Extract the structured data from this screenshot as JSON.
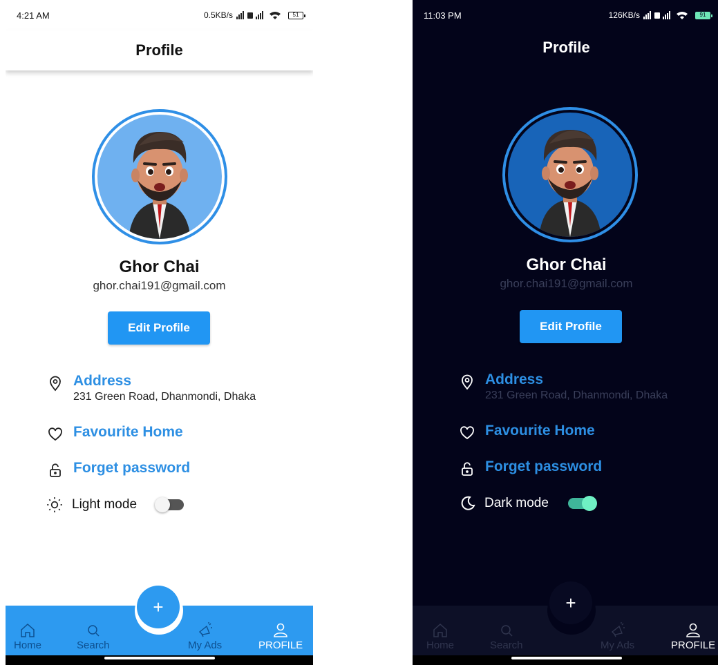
{
  "screens": {
    "light": {
      "status_time": "4:21 AM",
      "status_speed": "0.5KB/s",
      "battery": "51",
      "title": "Profile",
      "name": "Ghor Chai",
      "email": "ghor.chai191@gmail.com",
      "edit_label": "Edit Profile",
      "address_title": "Address",
      "address_value": "231 Green Road, Dhanmondi, Dhaka",
      "favourite_label": "Favourite Home",
      "forget_label": "Forget password",
      "mode_label": "Light mode",
      "mode_on": false,
      "nav": {
        "home": "Home",
        "search": "Search",
        "ads": "My Ads",
        "profile": "PROFILE"
      },
      "fab": "+"
    },
    "dark": {
      "status_time": "11:03 PM",
      "status_speed": "126KB/s",
      "battery": "91",
      "title": "Profile",
      "name": "Ghor Chai",
      "email": "ghor.chai191@gmail.com",
      "edit_label": "Edit Profile",
      "address_title": "Address",
      "address_value": "231 Green Road, Dhanmondi, Dhaka",
      "favourite_label": "Favourite Home",
      "forget_label": "Forget password",
      "mode_label": "Dark mode",
      "mode_on": true,
      "nav": {
        "home": "Home",
        "search": "Search",
        "ads": "My Ads",
        "profile": "PROFILE"
      },
      "fab": "+"
    }
  },
  "colors": {
    "accent": "#2196f3",
    "link_blue": "#2d8fe3",
    "dark_bg": "#03041a",
    "toggle_on": "#6ff0c4"
  },
  "icons": [
    "location-pin-icon",
    "heart-icon",
    "unlock-icon",
    "sun-icon",
    "moon-icon",
    "home-icon",
    "search-icon",
    "megaphone-icon",
    "person-icon",
    "plus-icon"
  ]
}
